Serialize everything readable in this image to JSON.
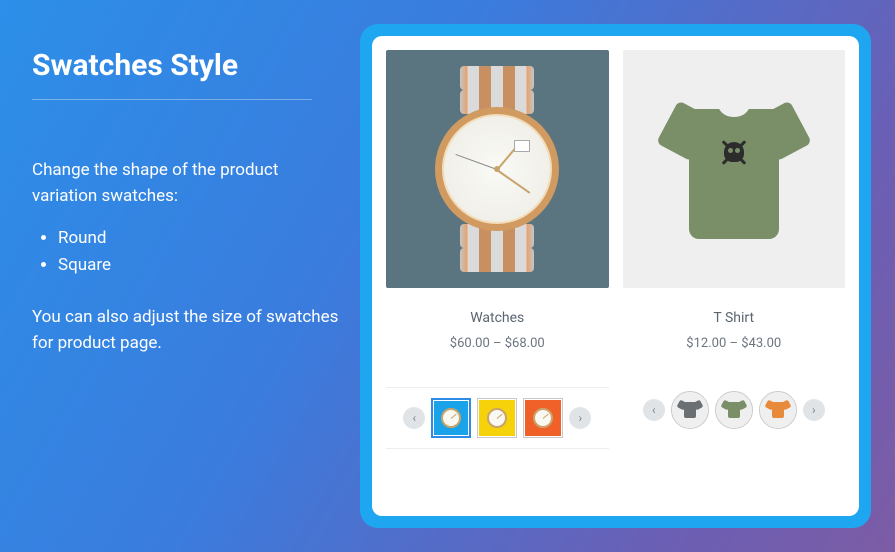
{
  "left": {
    "title": "Swatches Style",
    "desc1": "Change the shape of the product variation swatches:",
    "bullets": [
      "Round",
      "Square"
    ],
    "desc2": "You can also adjust the size of swatches for product page."
  },
  "products": [
    {
      "title": "Watches",
      "price": "$60.00 – $68.00",
      "swatch_style": "square",
      "swatches": [
        {
          "bg": "#1aa3e8",
          "selected": true
        },
        {
          "bg": "#f5d20a",
          "selected": false
        },
        {
          "bg": "#f0612a",
          "selected": false
        }
      ]
    },
    {
      "title": "T Shirt",
      "price": "$12.00 – $43.00",
      "swatch_style": "round",
      "swatches": [
        {
          "shirt_color": "#6a6f74",
          "bg": "#efefef"
        },
        {
          "shirt_color": "#7a8f68",
          "bg": "#efefef"
        },
        {
          "shirt_color": "#e88a3c",
          "bg": "#efefef"
        }
      ]
    }
  ]
}
